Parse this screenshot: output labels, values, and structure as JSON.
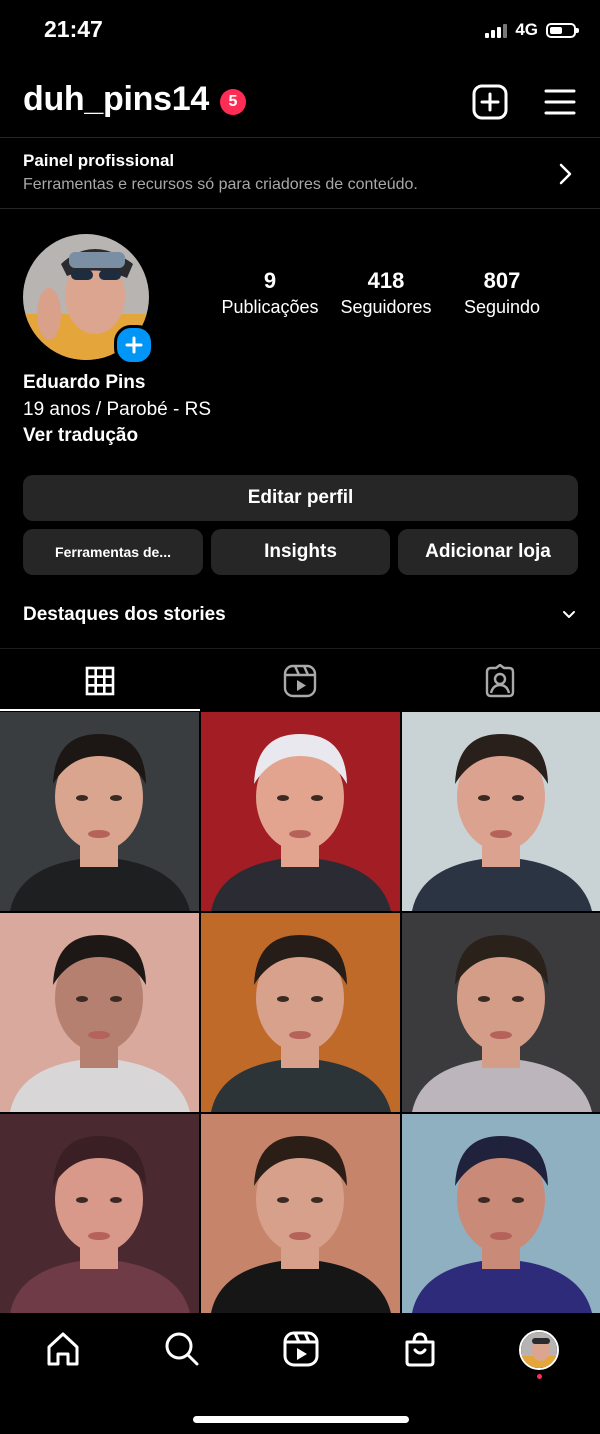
{
  "status_bar": {
    "time": "21:47",
    "network": "4G",
    "battery_level": 0.55
  },
  "header": {
    "username": "duh_pins14",
    "notifications": "5",
    "icons": [
      "new-post-icon",
      "menu-icon"
    ]
  },
  "pro_panel": {
    "title": "Painel profissional",
    "subtitle": "Ferramentas e recursos só para criadores de conteúdo."
  },
  "profile": {
    "full_name": "Eduardo Pins",
    "bio": "19 anos / Parobé - RS",
    "translate": "Ver tradução",
    "stats": [
      {
        "value": "9",
        "label": "Publicações"
      },
      {
        "value": "418",
        "label": "Seguidores"
      },
      {
        "value": "807",
        "label": "Seguindo"
      }
    ]
  },
  "buttons": {
    "edit": "Editar perfil",
    "tools": "Ferramentas de...",
    "insights": "Insights",
    "shop": "Adicionar loja"
  },
  "highlights": {
    "title": "Destaques dos stories"
  },
  "tabs": [
    "grid-icon",
    "reels-icon",
    "tagged-icon"
  ],
  "grid": {
    "posts": [
      {
        "bg": "#3a3d3f",
        "skin": "#d9a58e",
        "hair": "#1c1715",
        "shirt": "#1e1f21"
      },
      {
        "bg": "#a21e24",
        "skin": "#e2a38f",
        "hair": "#e8e8ee",
        "shirt": "#2a2b33"
      },
      {
        "bg": "#c9d2d4",
        "skin": "#dba290",
        "hair": "#2a201b",
        "shirt": "#2b3442"
      },
      {
        "bg": "#d8a99c",
        "skin": "#b68070",
        "hair": "#1d1715",
        "shirt": "#d9d6d8"
      },
      {
        "bg": "#c06a2a",
        "skin": "#d7a18b",
        "hair": "#261d18",
        "shirt": "#2d3438"
      },
      {
        "bg": "#3b3a3c",
        "skin": "#d39d88",
        "hair": "#2b211b",
        "shirt": "#bcb5bb"
      },
      {
        "bg": "#4a2a30",
        "skin": "#d8988a",
        "hair": "#3a1f24",
        "shirt": "#6e3b46"
      },
      {
        "bg": "#c6846a",
        "skin": "#d7a08a",
        "hair": "#2a1e17",
        "shirt": "#161616"
      },
      {
        "bg": "#8fb0c0",
        "skin": "#c98a78",
        "hair": "#20213a",
        "shirt": "#2e2c7a"
      }
    ]
  },
  "bottom_nav": [
    "home-icon",
    "search-icon",
    "reels-icon",
    "shop-icon",
    "profile-avatar"
  ]
}
